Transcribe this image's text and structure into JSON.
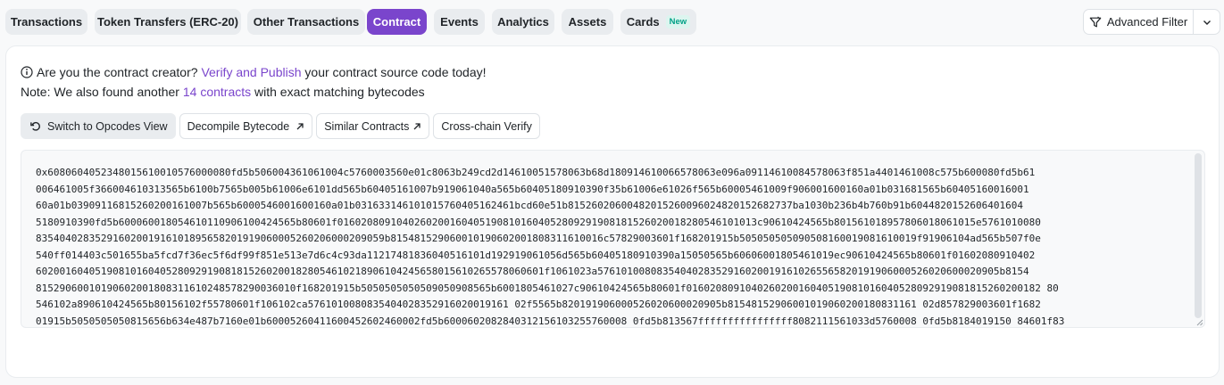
{
  "tabs": [
    {
      "label": "Transactions",
      "active": false
    },
    {
      "label": "Token Transfers (ERC-20)",
      "active": false
    },
    {
      "label": "Other Transactions",
      "active": false
    },
    {
      "label": "Contract",
      "active": true
    },
    {
      "label": "Events",
      "active": false
    },
    {
      "label": "Analytics",
      "active": false
    },
    {
      "label": "Assets",
      "active": false
    },
    {
      "label": "Cards",
      "active": false,
      "badge": "New"
    }
  ],
  "advanced_filter": {
    "label": "Advanced Filter",
    "icon": "filter-icon"
  },
  "notice": {
    "line1_prefix": "Are you the contract creator?",
    "line1_link": "Verify and Publish",
    "line1_suffix": "your contract source code today!",
    "line2_prefix": "Note: We also found another",
    "line2_link": "14 contracts",
    "line2_suffix": "with exact matching bytecodes"
  },
  "buttons": {
    "opcodes": "Switch to Opcodes View",
    "decompile": "Decompile Bytecode",
    "similar": "Similar Contracts",
    "crosschain": "Cross-chain Verify"
  },
  "bytecode_lines": [
    "0x6080604052348015610010576000080fd5b506004361061004c5760003560e01c8063b249cd2d14610051578063b68d180914610066578063e096a09114610084578063f851a4401461008c575b600080fd5b61",
    "006461005f366004610313565b6100b7565b005b61006e6101dd565b60405161007b919061040a565b60405180910390f35b61006e61026f565b60005461009f906001600160a01b031681565b60405160016001",
    "60a01b03909116815260200161007b565b6000546001600160a01b031633146101015760405162461bcd60e51b81526020600482015260096024820152682737ba1030b236b4b760b91b6044820152606401604",
    "5180910390fd5b600060018054610110906100424565b80601f01602080910402602001604051908101604052809291908181526020018280546101013c90610424565b801561018957806018061015e5761010080",
    "83540402835291602001916101895658201919060005260206000209059b815481529060010190602001808311610016c57829003601f168201915b505050505090508160019081610019f91906104ad565b507f0e",
    "540ff014403c501655ba5fcd7f36ec5f6df99f851e513e7d6c4c93da1121748183604051610­1d192919061056d565b60405180910390a15050565b60606001805461019ec90610424565b80601f01602080910402",
    "60200160405190810160405280929190818152602001828054610218906104245658015610265578060601f1061023a5761010080835404028352916020019161026556582019190600052602060002090​5b8154",
    "81529060010190602001808311610248578290036010f168201915b5050505050509050908565b6001805461027c90610424565b80601f016020809104026020016040519081016040528092919081815260200182 80",
    "546102a890610424565b80156102f55780601f106102ca5761010080835404028352916020019161 02f5565b820191906000526020600020905b81548152906001019060200180831161 02d857829003601f1682",
    "01915b5050505050815656b634e487b7160e01b60005260411600452602460002fd5b6000602082840312156103255760008 0fd5b813567ffffffffffffffff8082111561033d5760008 0fd5b8184019150 84601f83"
  ],
  "colors": {
    "accent": "#7a45cc",
    "tab_bg": "#e9ecef",
    "badge_green": "#00a186"
  }
}
